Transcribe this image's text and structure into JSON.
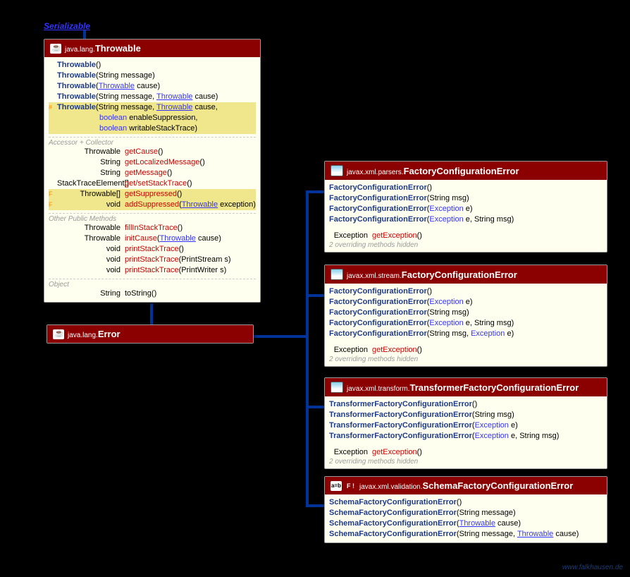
{
  "interface": {
    "label": "Serializable"
  },
  "throwable": {
    "pkg": "java.lang.",
    "cls": "Throwable",
    "ctors": [
      {
        "name": "Throwable",
        "params": "()"
      },
      {
        "name": "Throwable",
        "params_html": "(String message)"
      },
      {
        "name": "Throwable",
        "params_html": "(<a class='type-link u'>Throwable</a> cause)"
      },
      {
        "name": "Throwable",
        "params_html": "(String message, <a class='type-link u'>Throwable</a> cause)"
      },
      {
        "modif": "#",
        "name": "Throwable",
        "params_html": "(String message, <a class='type-link u'>Throwable</a> cause,",
        "extra1": "boolean enableSuppression,",
        "extra2": "boolean writableStackTrace)",
        "hl": true
      }
    ],
    "sections": [
      {
        "label": "Accessor + Collector",
        "rows": [
          {
            "ret": "Throwable",
            "name": "getCause",
            "params": "()"
          },
          {
            "ret": "String",
            "name": "getLocalizedMessage",
            "params": "()"
          },
          {
            "ret": "String",
            "name": "getMessage",
            "params": "()"
          },
          {
            "ret": "StackTraceElement[]",
            "ret_link": true,
            "name_html": "get/<span class='method-name'>setStackTrace</span>",
            "params": "()"
          },
          {
            "modif": "F",
            "ret": "Throwable[]",
            "name": "getSuppressed",
            "params": "()",
            "hl": true
          },
          {
            "modif": "F",
            "ret": "void",
            "name": "addSuppressed",
            "params_html": "(<a class='type-link u'>Throwable</a> exception)",
            "hl": true
          }
        ]
      },
      {
        "label": "Other Public Methods",
        "rows": [
          {
            "ret": "Throwable",
            "name": "fillInStackTrace",
            "params": "()"
          },
          {
            "ret": "Throwable",
            "name": "initCause",
            "params_html": "(<a class='type-link u'>Throwable</a> cause)"
          },
          {
            "ret": "void",
            "name": "printStackTrace",
            "params": "()"
          },
          {
            "ret": "void",
            "name": "printStackTrace",
            "params": "(PrintStream s)"
          },
          {
            "ret": "void",
            "name": "printStackTrace",
            "params": "(PrintWriter s)"
          }
        ]
      },
      {
        "label": "Object",
        "rows": [
          {
            "ret": "String",
            "name_plain": "toString",
            "params": "()"
          }
        ]
      }
    ]
  },
  "error": {
    "pkg": "java.lang.",
    "cls": "Error"
  },
  "factories": [
    {
      "icon": "screen",
      "pkg": "javax.xml.parsers.",
      "cls": "FactoryConfigurationError",
      "ctors": [
        {
          "name": "FactoryConfigurationError",
          "params": "()"
        },
        {
          "name": "FactoryConfigurationError",
          "params_html": "(String msg)"
        },
        {
          "name": "FactoryConfigurationError",
          "params_html": "(<a class='type-link'>Exception</a> e)"
        },
        {
          "name": "FactoryConfigurationError",
          "params_html": "(<a class='type-link'>Exception</a> e, String msg)"
        }
      ],
      "method": {
        "ret": "Exception",
        "name": "getException",
        "params": "()"
      },
      "note": "2 overriding methods hidden"
    },
    {
      "icon": "screen",
      "pkg": "javax.xml.stream.",
      "cls": "FactoryConfigurationError",
      "ctors": [
        {
          "name": "FactoryConfigurationError",
          "params": "()"
        },
        {
          "name": "FactoryConfigurationError",
          "params_html": "(<a class='type-link'>Exception</a> e)"
        },
        {
          "name": "FactoryConfigurationError",
          "params_html": "(String msg)"
        },
        {
          "name": "FactoryConfigurationError",
          "params_html": "(<a class='type-link'>Exception</a> e, String msg)"
        },
        {
          "name": "FactoryConfigurationError",
          "params_html": "(String msg, <a class='type-link'>Exception</a> e)"
        }
      ],
      "method": {
        "ret": "Exception",
        "name": "getException",
        "params": "()"
      },
      "note": "2 overriding methods hidden"
    },
    {
      "icon": "screen",
      "pkg": "javax.xml.transform.",
      "cls": "TransformerFactoryConfigurationError",
      "ctors": [
        {
          "name": "TransformerFactoryConfigurationError",
          "params": "()"
        },
        {
          "name": "TransformerFactoryConfigurationError",
          "params_html": "(String msg)"
        },
        {
          "name": "TransformerFactoryConfigurationError",
          "params_html": "(<a class='type-link'>Exception</a> e)"
        },
        {
          "name": "TransformerFactoryConfigurationError",
          "params_html": "(<a class='type-link'>Exception</a> e, String msg)"
        }
      ],
      "method": {
        "ret": "Exception",
        "name": "getException",
        "params": "()"
      },
      "note": "2 overriding methods hidden"
    },
    {
      "icon": "ab",
      "final": "F !",
      "pkg": "javax.xml.validation.",
      "cls": "SchemaFactoryConfigurationError",
      "ctors": [
        {
          "name": "SchemaFactoryConfigurationError",
          "params": "()"
        },
        {
          "name": "SchemaFactoryConfigurationError",
          "params_html": "(String message)"
        },
        {
          "name": "SchemaFactoryConfigurationError",
          "params_html": "(<a class='type-link u'>Throwable</a> cause)"
        },
        {
          "name": "SchemaFactoryConfigurationError",
          "params_html": "(String message, <a class='type-link u'>Throwable</a> cause)"
        }
      ]
    }
  ],
  "watermark": "www.falkhausen.de"
}
